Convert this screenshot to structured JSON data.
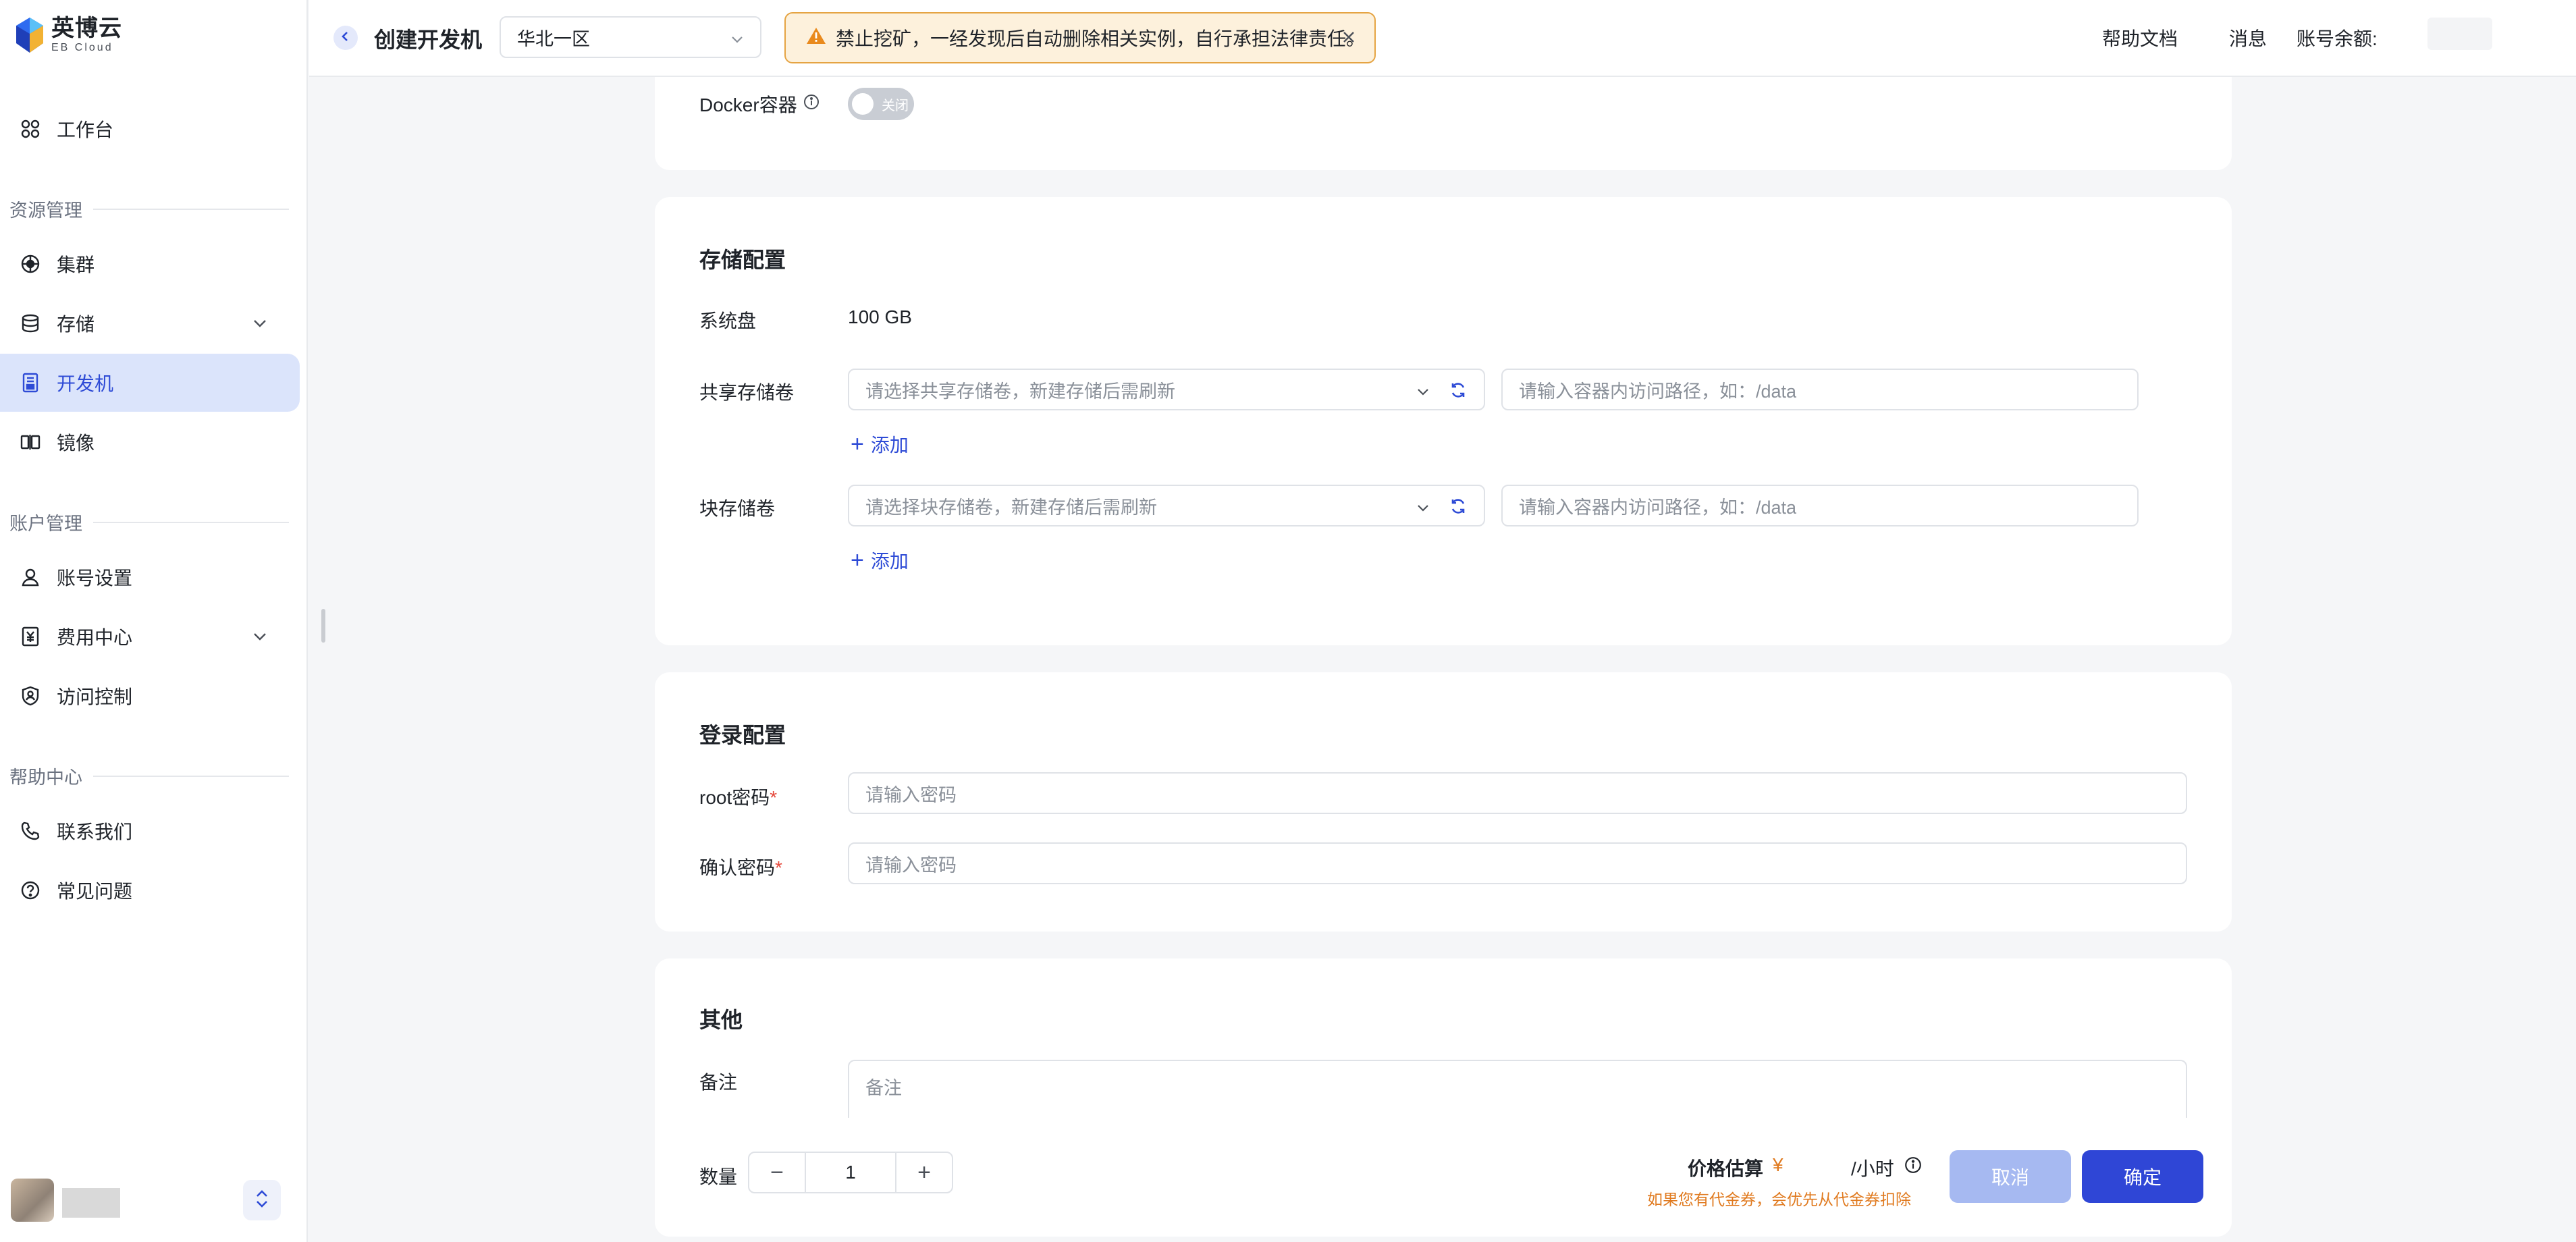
{
  "brand": {
    "name": "英博云",
    "sub": "EB Cloud"
  },
  "sidebar": {
    "workspace": "工作台",
    "groups": {
      "resource": "资源管理",
      "account": "账户管理",
      "help": "帮助中心"
    },
    "items": {
      "cluster": "集群",
      "storage": "存储",
      "devmachine": "开发机",
      "image": "镜像",
      "account_settings": "账号设置",
      "billing": "费用中心",
      "access_control": "访问控制",
      "contact": "联系我们",
      "faq": "常见问题"
    }
  },
  "header": {
    "title": "创建开发机",
    "region": "华北一区",
    "alert": "禁止挖矿，一经发现后自动删除相关实例，自行承担法律责任。",
    "help_docs": "帮助文档",
    "messages": "消息",
    "balance_label": "账号余额:"
  },
  "docker": {
    "label": "Docker容器",
    "toggle_text": "关闭"
  },
  "storage": {
    "title": "存储配置",
    "system_disk_label": "系统盘",
    "system_disk_value": "100 GB",
    "shared_label": "共享存储卷",
    "shared_placeholder": "请选择共享存储卷，新建存储后需刷新",
    "shared_path_placeholder": "请输入容器内访问路径，如：/data",
    "block_label": "块存储卷",
    "block_placeholder": "请选择块存储卷，新建存储后需刷新",
    "block_path_placeholder": "请输入容器内访问路径，如：/data",
    "add_label": "添加"
  },
  "login": {
    "title": "登录配置",
    "root_password_label": "root密码",
    "root_password_placeholder": "请输入密码",
    "confirm_password_label": "确认密码",
    "confirm_password_placeholder": "请输入密码",
    "required_mark": "*"
  },
  "other": {
    "title": "其他",
    "remark_label": "备注",
    "remark_placeholder": "备注"
  },
  "footer": {
    "quantity_label": "数量",
    "quantity_value": "1",
    "minus": "−",
    "plus": "+",
    "price_label": "价格估算",
    "currency": "¥",
    "per_hour": "/小时",
    "voucher_note": "如果您有代金券，会优先从代金券扣除",
    "cancel": "取消",
    "confirm": "确定"
  },
  "colors": {
    "accent": "#2f46d6",
    "active_bg": "#dbe4fb",
    "warning_border": "#e5a443",
    "warning_bg": "#fdf1dc"
  }
}
